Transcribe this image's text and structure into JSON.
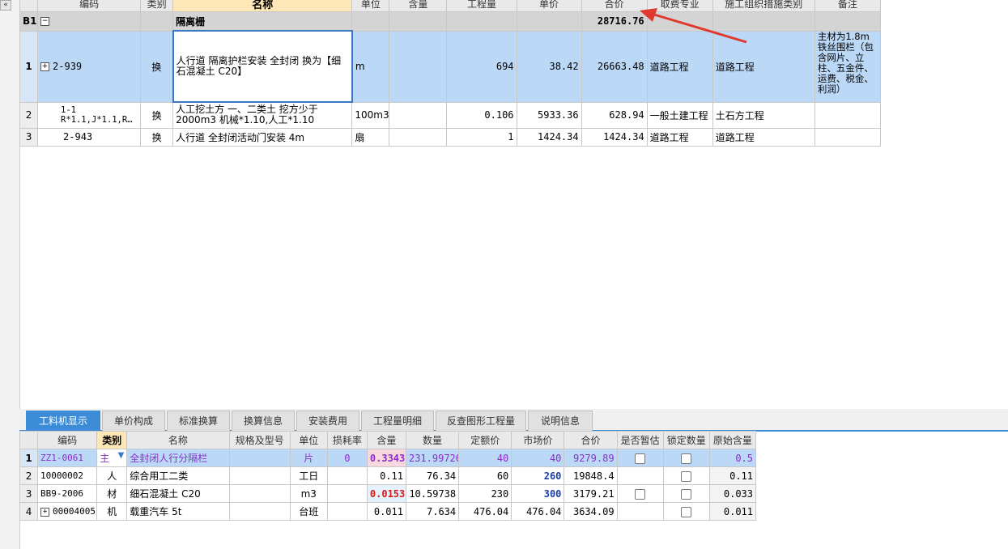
{
  "top_table": {
    "headers": [
      "",
      "编码",
      "类别",
      "名称",
      "单位",
      "含量",
      "工程量",
      "单价",
      "合价",
      "取费专业",
      "施工组织措施类别",
      "备注"
    ],
    "group_row": {
      "num": "B1",
      "name": "隔离栅",
      "total": "28716.76"
    },
    "rows": [
      {
        "num": "1",
        "code": "2-939",
        "type": "换",
        "name": "人行道 隔离护栏安装 全封闭  换为【细石混凝土 C20】",
        "unit": "m",
        "content": "",
        "qty": "694",
        "price": "38.42",
        "total": "26663.48",
        "fee_major": "道路工程",
        "measure_cat": "道路工程",
        "remark": "主材为1.8m铁丝围栏（包含网片、立柱、五金件、运费、税金、利润）"
      },
      {
        "num": "2",
        "code_line1": "1-1",
        "code_line2": "R*1.1,J*1.1,R…",
        "type": "换",
        "name": "人工挖土方 一、二类土  挖方少于2000m3 机械*1.10,人工*1.10",
        "unit": "100m3",
        "content": "",
        "qty": "0.106",
        "price": "5933.36",
        "total": "628.94",
        "fee_major": "一般土建工程",
        "measure_cat": "土石方工程",
        "remark": ""
      },
      {
        "num": "3",
        "code": "2-943",
        "type": "换",
        "name": "人行道 全封闭活动门安装 4m",
        "unit": "扇",
        "content": "",
        "qty": "1",
        "price": "1424.34",
        "total": "1424.34",
        "fee_major": "道路工程",
        "measure_cat": "道路工程",
        "remark": ""
      }
    ]
  },
  "tabs": [
    "工料机显示",
    "单价构成",
    "标准换算",
    "换算信息",
    "安装费用",
    "工程量明细",
    "反查图形工程量",
    "说明信息"
  ],
  "bottom_table": {
    "headers": [
      "",
      "编码",
      "类别",
      "名称",
      "规格及型号",
      "单位",
      "损耗率",
      "含量",
      "数量",
      "定额价",
      "市场价",
      "合价",
      "是否暂估",
      "锁定数量",
      "原始含量"
    ],
    "rows": [
      {
        "num": "1",
        "code": "ZZ1-0061",
        "type": "主",
        "name": "全封闭人行分隔栏",
        "spec": "",
        "unit": "片",
        "loss": "0",
        "content": "0.3343",
        "amount": "231.99726",
        "quota_price": "40",
        "market_price": "40",
        "total": "9279.89",
        "orig": "0.5"
      },
      {
        "num": "2",
        "code": "10000002",
        "type": "人",
        "name": "综合用工二类",
        "spec": "",
        "unit": "工日",
        "loss": "",
        "content": "0.11",
        "amount": "76.34",
        "quota_price": "60",
        "market_price": "260",
        "total": "19848.4",
        "orig": "0.11"
      },
      {
        "num": "3",
        "code": "BB9-2006",
        "type": "材",
        "name": "细石混凝土 C20",
        "spec": "",
        "unit": "m3",
        "loss": "",
        "content": "0.0153",
        "amount": "10.59738",
        "quota_price": "230",
        "market_price": "300",
        "total": "3179.21",
        "orig": "0.033"
      },
      {
        "num": "4",
        "code": "00004005",
        "type": "机",
        "name": "载重汽车 5t",
        "spec": "",
        "unit": "台班",
        "loss": "",
        "content": "0.011",
        "amount": "7.634",
        "quota_price": "476.04",
        "market_price": "476.04",
        "total": "3634.09",
        "orig": "0.011"
      }
    ]
  },
  "icons": {
    "collapse": "double-chevron-left-icon",
    "minus": "minus-box-icon",
    "plus": "plus-box-icon",
    "arrow": "red-arrow-icon"
  },
  "colors": {
    "accent": "#3b8bd6",
    "selection": "#bcd8f7",
    "arrow": "#e03a2f"
  }
}
